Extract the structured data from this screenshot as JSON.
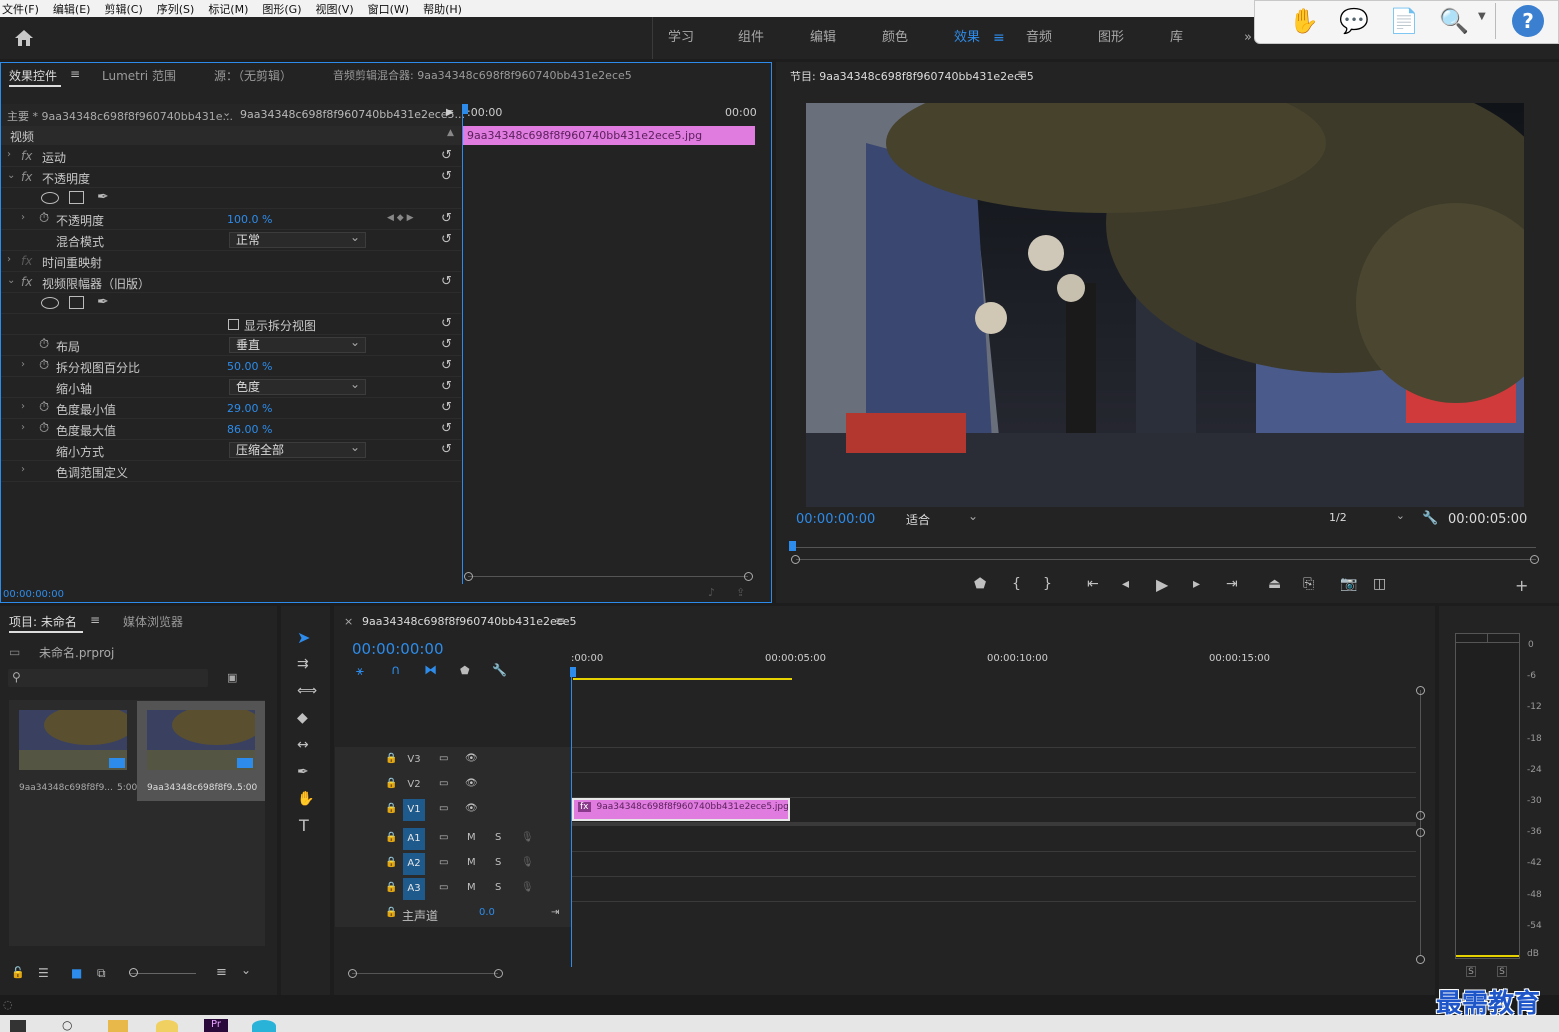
{
  "menu": [
    "文件(F)",
    "编辑(E)",
    "剪辑(C)",
    "序列(S)",
    "标记(M)",
    "图形(G)",
    "视图(V)",
    "窗口(W)",
    "帮助(H)"
  ],
  "workspaces": [
    "学习",
    "组件",
    "编辑",
    "颜色",
    "效果",
    "音频",
    "图形",
    "库"
  ],
  "active_workspace": "效果",
  "ws_more": "»",
  "ec_tabs": {
    "effect_controls": "效果控件",
    "lumetri": "Lumetri 范围",
    "source": "源：（无剪辑）",
    "mixer": "音频剪辑混合器: 9aa34348c698f8f960740bb431e2ece5"
  },
  "ec": {
    "master": "主要 * 9aa34348c698f8f960740bb431e...",
    "clip_seq": "9aa34348c698f8f960740bb431e2ece5...",
    "video_header": "视频",
    "tc_start": ":00:00",
    "tc_end": "00:00",
    "clip_name": "9aa34348c698f8f960740bb431e2ece5.jpg",
    "footer_tc": "00:00:00:00",
    "rows": {
      "motion": "运动",
      "opacity_group": "不透明度",
      "opacity": "不透明度",
      "opacity_val": "100.0 %",
      "blend": "混合模式",
      "blend_val": "正常",
      "time_remap": "时间重映射",
      "limiter": "视频限幅器（旧版）",
      "show_split": "显示拆分视图",
      "layout": "布局",
      "layout_val": "垂直",
      "split_pct": "拆分视图百分比",
      "split_pct_val": "50.00 %",
      "reduce_axis": "缩小轴",
      "reduce_axis_val": "色度",
      "chroma_min": "色度最小值",
      "chroma_min_val": "29.00 %",
      "chroma_max": "色度最大值",
      "chroma_max_val": "86.00 %",
      "reduce_method": "缩小方式",
      "reduce_method_val": "压缩全部",
      "tonal": "色调范围定义"
    }
  },
  "program": {
    "title": "节目: 9aa34348c698f8f960740bb431e2ece5",
    "tc": "00:00:00:00",
    "fit": "适合",
    "res": "1/2",
    "duration": "00:00:05:00"
  },
  "project": {
    "tab": "项目: 未命名",
    "media": "媒体浏览器",
    "file": "未命名.prproj",
    "items": [
      {
        "name": "9aa34348c698f8f9...",
        "dur": "5:00"
      },
      {
        "name": "9aa34348c698f8f9...",
        "dur": "5:00"
      }
    ]
  },
  "timeline": {
    "tab": "9aa34348c698f8f960740bb431e2ece5",
    "tc": "00:00:00:00",
    "ruler": [
      ":00:00",
      "00:00:05:00",
      "00:00:10:00",
      "00:00:15:00"
    ],
    "video_tracks": [
      "V3",
      "V2",
      "V1"
    ],
    "audio_tracks": [
      "A1",
      "A2",
      "A3"
    ],
    "master": "主声道",
    "master_val": "0.0",
    "clip": "9aa34348c698f8f960740bb431e2ece5.jpg"
  },
  "meter": {
    "ticks": [
      "0",
      "-6",
      "-12",
      "-18",
      "-24",
      "-30",
      "-36",
      "-42",
      "-48",
      "-54",
      "dB"
    ],
    "solo": [
      "S",
      "S"
    ]
  },
  "watermark": "最需教育"
}
